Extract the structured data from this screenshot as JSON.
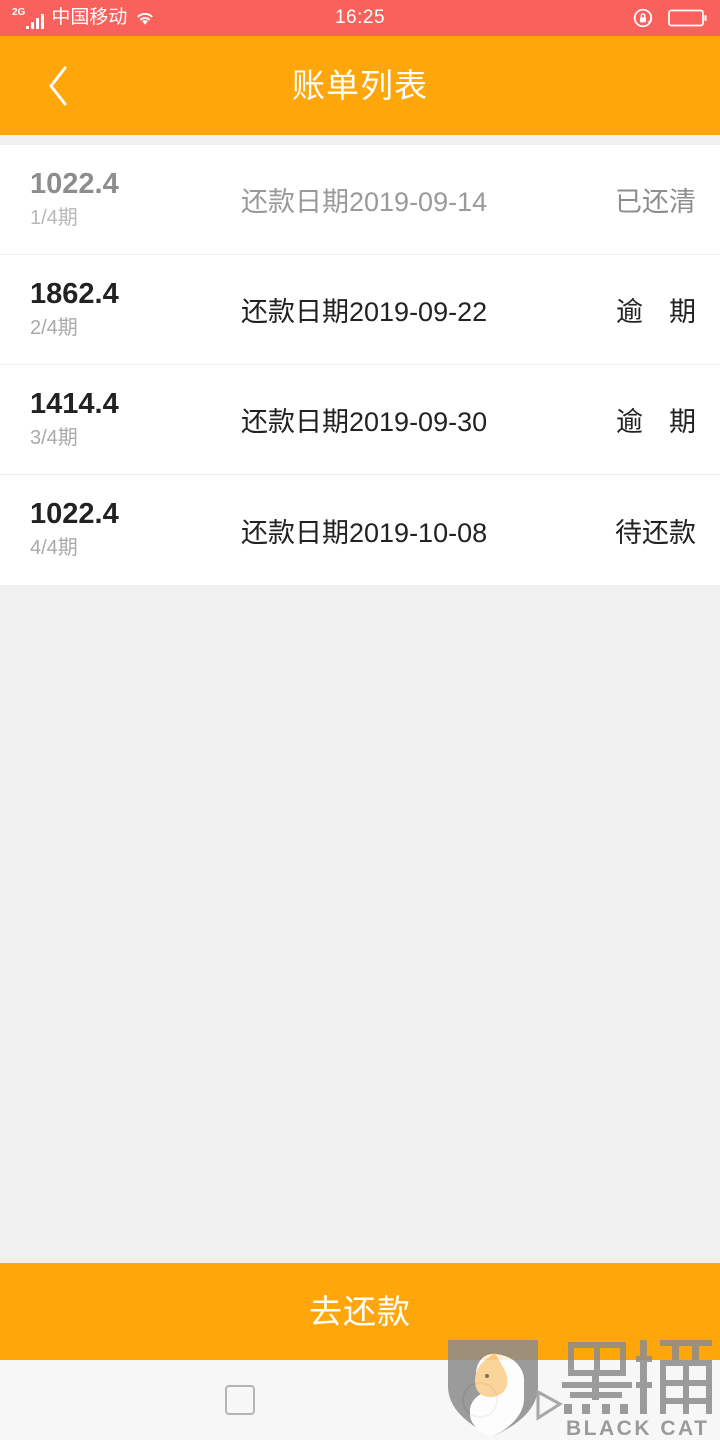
{
  "status_bar": {
    "network_generation": "2G",
    "carrier": "中国移动",
    "wifi_icon": "wifi-icon",
    "time": "16:25",
    "rotation_lock_icon": "rotation-lock-icon",
    "battery_icon": "battery-icon",
    "background_color": "#f9615c",
    "text_color": "#ffffff"
  },
  "header": {
    "back_icon": "chevron-left-icon",
    "title": "账单列表",
    "background_color": "#ffa60a",
    "text_color": "#ffffff"
  },
  "bill_list": {
    "rows": [
      {
        "amount": "1022.4",
        "term": "1/4期",
        "date": "还款日期2019-09-14",
        "status": "已还清",
        "state": "paid"
      },
      {
        "amount": "1862.4",
        "term": "2/4期",
        "date": "还款日期2019-09-22",
        "status_char_1": "逾",
        "status_char_2": "期",
        "status": "逾 期",
        "state": "overdue"
      },
      {
        "amount": "1414.4",
        "term": "3/4期",
        "date": "还款日期2019-09-30",
        "status_char_1": "逾",
        "status_char_2": "期",
        "status": "逾 期",
        "state": "overdue"
      },
      {
        "amount": "1022.4",
        "term": "4/4期",
        "date": "还款日期2019-10-08",
        "status": "待还款",
        "state": "pending"
      }
    ]
  },
  "footer": {
    "repay_button_label": "去还款",
    "background_color": "#ffa60a"
  },
  "nav_bar": {
    "recents_icon": "square-recents-icon",
    "home_icon": "circle-home-icon",
    "background_color": "#f7f7f7"
  },
  "watermark": {
    "brand_cn": "黑猫",
    "brand_en": "BLACK CAT"
  }
}
